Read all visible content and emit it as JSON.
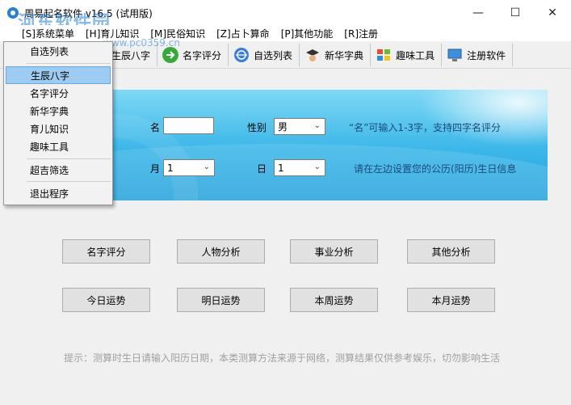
{
  "window": {
    "title": "周易起名软件 v16.5 (试用版)",
    "watermark": "河东软件园",
    "watermark_url": "www.pc0359.cn",
    "minimize": "—",
    "maximize": "☐",
    "close": "✕"
  },
  "menubar": {
    "items": [
      {
        "label": "[S]系统菜单"
      },
      {
        "label": "[H]育儿知识"
      },
      {
        "label": "[M]民俗知识"
      },
      {
        "label": "[Z]占卜算命"
      },
      {
        "label": "[P]其他功能"
      },
      {
        "label": "[R]注册"
      }
    ]
  },
  "toolbar": {
    "items": [
      {
        "label": "生辰八字",
        "icon": "calendar-icon"
      },
      {
        "label": "名字评分",
        "icon": "arrow-right-icon"
      },
      {
        "label": "自选列表",
        "icon": "globe-icon"
      },
      {
        "label": "新华字典",
        "icon": "scholar-icon"
      },
      {
        "label": "趣味工具",
        "icon": "windows-icon"
      },
      {
        "label": "注册软件",
        "icon": "monitor-icon"
      }
    ]
  },
  "form": {
    "name_label": "名",
    "name_value": "",
    "gender_label": "性别",
    "gender_value": "男",
    "name_hint": "“名”可输入1-3字，支持四字名评分",
    "month_label": "月",
    "month_value": "1",
    "day_label": "日",
    "day_value": "1",
    "date_hint": "请在左边设置您的公历(阳历)生日信息"
  },
  "buttons": {
    "row1": [
      "名字评分",
      "人物分析",
      "事业分析",
      "其他分析"
    ],
    "row2": [
      "今日运势",
      "明日运势",
      "本周运势",
      "本月运势"
    ]
  },
  "footer_tip": "提示：测算时生日请输入阳历日期，本类测算方法来源于网络，测算结果仅供参考娱乐，切勿影响生活",
  "dropdown": {
    "items": [
      "自选列表",
      "生辰八字",
      "名字评分",
      "新华字典",
      "育儿知识",
      "趣味工具",
      "超吉筛选",
      "退出程序"
    ],
    "highlighted": "生辰八字"
  },
  "colors": {
    "banner_top": "#7fd8f5",
    "banner_bottom": "#2aa4dc",
    "highlight": "#9dcbf1"
  }
}
